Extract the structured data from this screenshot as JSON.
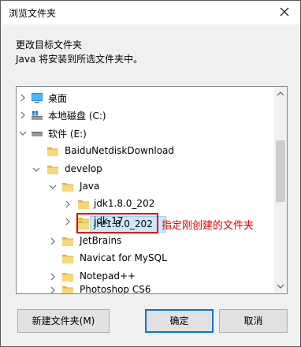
{
  "dialog": {
    "title": "浏览文件夹",
    "instruction_line1": "更改目标文件夹",
    "instruction_line2": "Java 将安装到所选文件夹中。"
  },
  "tree": {
    "items": [
      {
        "label": "桌面",
        "icon": "desktop-icon",
        "chevron": "right"
      },
      {
        "label": "本地磁盘 (C:)",
        "icon": "drive-icon",
        "chevron": "right"
      },
      {
        "label": "软件 (E:)",
        "icon": "drive-icon",
        "chevron": "down"
      },
      {
        "label": "BaiduNetdiskDownload",
        "icon": "folder-icon",
        "chevron": "none"
      },
      {
        "label": "develop",
        "icon": "folder-icon",
        "chevron": "down"
      },
      {
        "label": "Java",
        "icon": "folder-icon",
        "chevron": "down"
      },
      {
        "label": "jdk1.8.0_202",
        "icon": "folder-icon",
        "chevron": "right"
      },
      {
        "label": "jdk-17",
        "icon": "folder-icon",
        "chevron": "right"
      },
      {
        "label": "jre1.8.0_202",
        "icon": "folder-icon",
        "chevron": "none",
        "selected": true
      },
      {
        "label": "JetBrains",
        "icon": "folder-icon",
        "chevron": "right"
      },
      {
        "label": "Navicat for MySQL",
        "icon": "folder-icon",
        "chevron": "none"
      },
      {
        "label": "Notepad++",
        "icon": "folder-icon",
        "chevron": "right"
      },
      {
        "label": "Photoshop CS6",
        "icon": "folder-icon",
        "chevron": "right"
      }
    ]
  },
  "annotation": {
    "text": "指定刚创建的文件夹",
    "color": "#e00000"
  },
  "buttons": {
    "new_folder": "新建文件夹(M)",
    "ok": "确定",
    "cancel": "取消"
  },
  "colors": {
    "selection": "#cce8ff",
    "folder": "#f8d775",
    "accent": "#0078d7"
  }
}
